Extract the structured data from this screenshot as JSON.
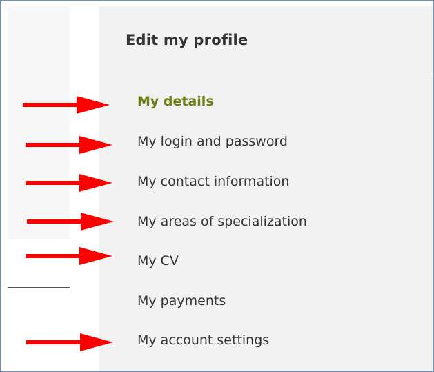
{
  "panel": {
    "title": "Edit my profile"
  },
  "menu": {
    "items": [
      {
        "label": "My details",
        "active": true
      },
      {
        "label": "My login and password"
      },
      {
        "label": "My contact information"
      },
      {
        "label": "My areas of specialization"
      },
      {
        "label": "My CV"
      },
      {
        "label": "My payments"
      },
      {
        "label": "My account settings"
      }
    ]
  },
  "colors": {
    "active_item": "#6b7f12",
    "text": "#333333",
    "panel_bg": "#f2f2f2",
    "arrow": "#ff0000"
  }
}
